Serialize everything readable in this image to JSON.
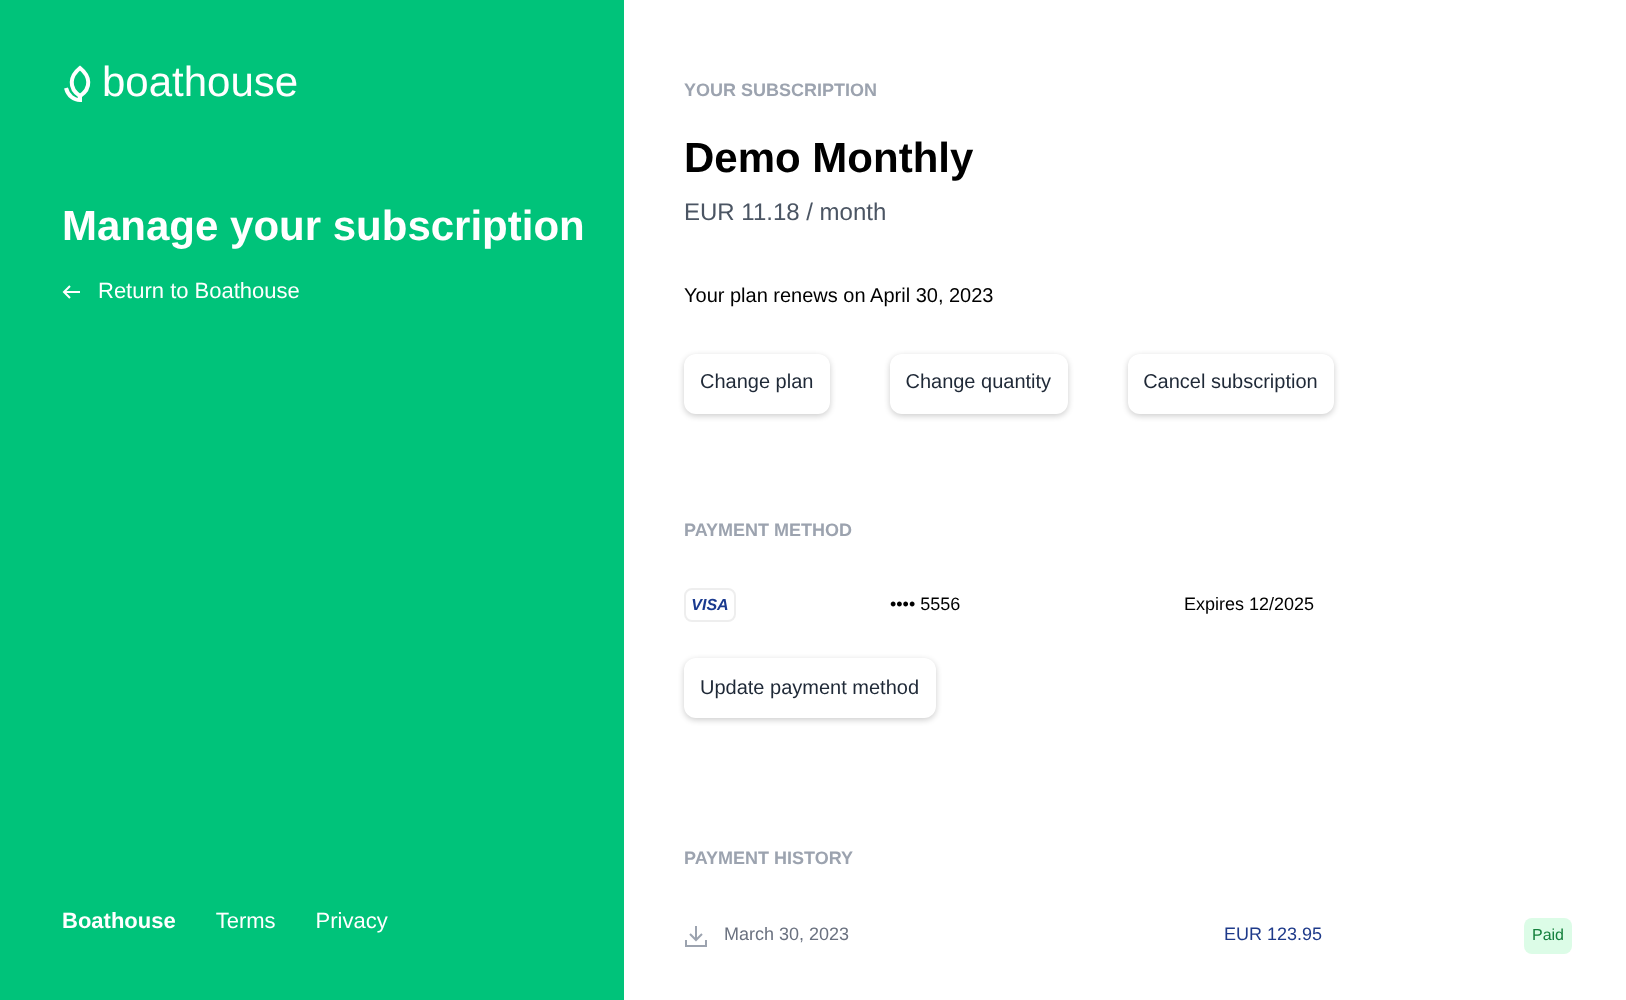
{
  "sidebar": {
    "logo": "boathouse",
    "title": "Manage your subscription",
    "back_link": "Return to Boathouse",
    "footer": {
      "brand": "Boathouse",
      "links": [
        "Terms",
        "Privacy"
      ]
    }
  },
  "subscription": {
    "heading": "YOUR SUBSCRIPTION",
    "plan": "Demo Monthly",
    "price": "EUR 11.18 / month",
    "renewal": "Your plan renews on April 30, 2023",
    "buttons": [
      "Change plan",
      "Change quantity",
      "Cancel subscription"
    ]
  },
  "payment_method": {
    "heading": "PAYMENT METHOD",
    "card_brand": "VISA",
    "card_number": "•••• 5556",
    "expiry": "Expires 12/2025",
    "button": "Update payment method"
  },
  "payment_history": {
    "heading": "PAYMENT HISTORY",
    "rows": [
      {
        "date": "March 30, 2023",
        "amount": "EUR 123.95",
        "status": "Paid"
      }
    ]
  }
}
